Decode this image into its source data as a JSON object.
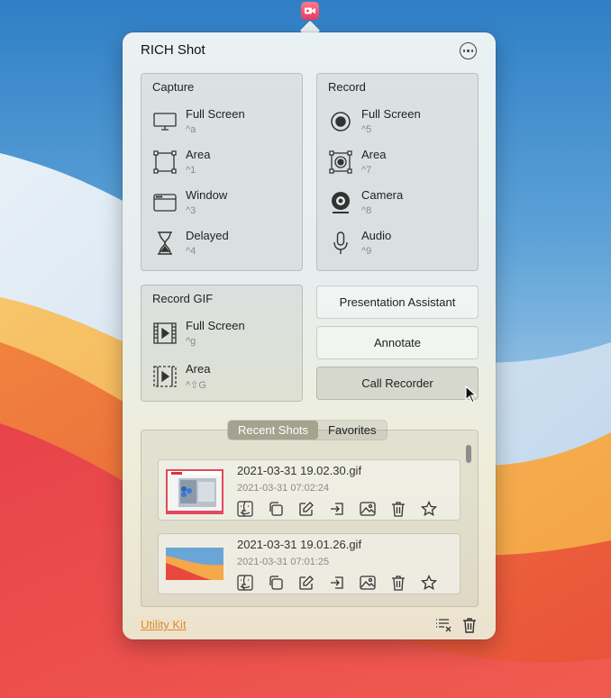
{
  "app": {
    "title": "RICH Shot",
    "menubar_icon": "video-camera-icon",
    "more_icon": "ellipsis-circle-icon"
  },
  "capture": {
    "title": "Capture",
    "items": [
      {
        "label": "Full Screen",
        "shortcut": "^a",
        "icon": "monitor-icon"
      },
      {
        "label": "Area",
        "shortcut": "^1",
        "icon": "area-select-icon"
      },
      {
        "label": "Window",
        "shortcut": "^3",
        "icon": "window-icon"
      },
      {
        "label": "Delayed",
        "shortcut": "^4",
        "icon": "hourglass-icon"
      }
    ]
  },
  "record": {
    "title": "Record",
    "items": [
      {
        "label": "Full Screen",
        "shortcut": "^5",
        "icon": "record-circle-icon"
      },
      {
        "label": "Area",
        "shortcut": "^7",
        "icon": "area-record-icon"
      },
      {
        "label": "Camera",
        "shortcut": "^8",
        "icon": "webcam-icon"
      },
      {
        "label": "Audio",
        "shortcut": "^9",
        "icon": "microphone-icon"
      }
    ]
  },
  "record_gif": {
    "title": "Record GIF",
    "items": [
      {
        "label": "Full Screen",
        "shortcut": "^g",
        "icon": "film-play-icon"
      },
      {
        "label": "Area",
        "shortcut": "^⇧G",
        "icon": "film-area-icon"
      }
    ]
  },
  "buttons": {
    "presentation": "Presentation Assistant",
    "annotate": "Annotate",
    "call_recorder": "Call Recorder"
  },
  "tabs": {
    "recent": "Recent Shots",
    "favorites": "Favorites",
    "active": "recent"
  },
  "shots": [
    {
      "name": "2021-03-31 19.02.30.gif",
      "time": "2021-03-31 07:02:24"
    },
    {
      "name": "2021-03-31 19.01.26.gif",
      "time": "2021-03-31 07:01:25"
    }
  ],
  "shot_actions": [
    "finder-icon",
    "copy-icon",
    "edit-icon",
    "share-icon",
    "image-icon",
    "trash-icon",
    "star-icon"
  ],
  "footer": {
    "link": "Utility Kit",
    "clear_list_icon": "clear-list-icon",
    "delete_all_icon": "trash-icon"
  },
  "colors": {
    "link": "#e0892a",
    "tab_active": "#a3a38e",
    "menubar_icon": "#e93a64"
  }
}
